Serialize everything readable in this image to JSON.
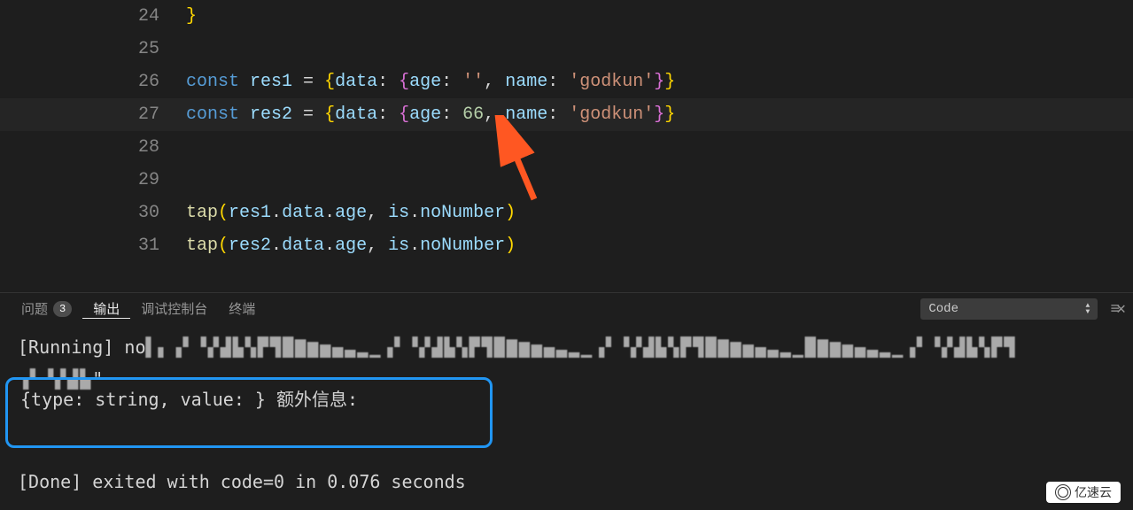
{
  "editor": {
    "lines": [
      {
        "num": "24",
        "tokens": [
          {
            "t": "}",
            "c": "brace"
          }
        ]
      },
      {
        "num": "25",
        "tokens": []
      },
      {
        "num": "26",
        "tokens": [
          {
            "t": "const",
            "c": "kw-const"
          },
          {
            "t": " ",
            "c": ""
          },
          {
            "t": "res1",
            "c": "var-name"
          },
          {
            "t": " = ",
            "c": "op"
          },
          {
            "t": "{",
            "c": "brace"
          },
          {
            "t": "data",
            "c": "prop"
          },
          {
            "t": ": ",
            "c": "op"
          },
          {
            "t": "{",
            "c": "brace2"
          },
          {
            "t": "age",
            "c": "prop"
          },
          {
            "t": ": ",
            "c": "op"
          },
          {
            "t": "''",
            "c": "str"
          },
          {
            "t": ", ",
            "c": "op"
          },
          {
            "t": "name",
            "c": "prop"
          },
          {
            "t": ": ",
            "c": "op"
          },
          {
            "t": "'godkun'",
            "c": "str"
          },
          {
            "t": "}",
            "c": "brace2"
          },
          {
            "t": "}",
            "c": "brace"
          }
        ]
      },
      {
        "num": "27",
        "highlight": true,
        "tokens": [
          {
            "t": "const",
            "c": "kw-const"
          },
          {
            "t": " ",
            "c": ""
          },
          {
            "t": "res2",
            "c": "var-name"
          },
          {
            "t": " = ",
            "c": "op"
          },
          {
            "t": "{",
            "c": "brace"
          },
          {
            "t": "data",
            "c": "prop"
          },
          {
            "t": ": ",
            "c": "op"
          },
          {
            "t": "{",
            "c": "brace2"
          },
          {
            "t": "age",
            "c": "prop"
          },
          {
            "t": ": ",
            "c": "op"
          },
          {
            "t": "66",
            "c": "num"
          },
          {
            "t": ", ",
            "c": "op"
          },
          {
            "t": "name",
            "c": "prop"
          },
          {
            "t": ": ",
            "c": "op"
          },
          {
            "t": "'godkun'",
            "c": "str"
          },
          {
            "t": "}",
            "c": "brace2"
          },
          {
            "t": "}",
            "c": "brace"
          }
        ]
      },
      {
        "num": "28",
        "tokens": []
      },
      {
        "num": "29",
        "tokens": []
      },
      {
        "num": "30",
        "tokens": [
          {
            "t": "tap",
            "c": "fn"
          },
          {
            "t": "(",
            "c": "brace"
          },
          {
            "t": "res1",
            "c": "var-name"
          },
          {
            "t": ".",
            "c": "op"
          },
          {
            "t": "data",
            "c": "prop"
          },
          {
            "t": ".",
            "c": "op"
          },
          {
            "t": "age",
            "c": "prop"
          },
          {
            "t": ", ",
            "c": "op"
          },
          {
            "t": "is",
            "c": "var-name"
          },
          {
            "t": ".",
            "c": "op"
          },
          {
            "t": "noNumber",
            "c": "prop"
          },
          {
            "t": ")",
            "c": "brace"
          }
        ]
      },
      {
        "num": "31",
        "tokens": [
          {
            "t": "tap",
            "c": "fn"
          },
          {
            "t": "(",
            "c": "brace"
          },
          {
            "t": "res2",
            "c": "var-name"
          },
          {
            "t": ".",
            "c": "op"
          },
          {
            "t": "data",
            "c": "prop"
          },
          {
            "t": ".",
            "c": "op"
          },
          {
            "t": "age",
            "c": "prop"
          },
          {
            "t": ", ",
            "c": "op"
          },
          {
            "t": "is",
            "c": "var-name"
          },
          {
            "t": ".",
            "c": "op"
          },
          {
            "t": "noNumber",
            "c": "prop"
          },
          {
            "t": ")",
            "c": "brace"
          }
        ]
      }
    ]
  },
  "panel": {
    "tabs": {
      "problems": "问题",
      "problems_count": "3",
      "output": "输出",
      "debug_console": "调试控制台",
      "terminal": "终端"
    },
    "dropdown": "Code"
  },
  "output": {
    "running_prefix": "[Running] no",
    "highlighted": "{type: string, value:  } 额外信息:",
    "done": "[Done] exited with code=0 in 0.076 seconds"
  },
  "watermark": "亿速云"
}
